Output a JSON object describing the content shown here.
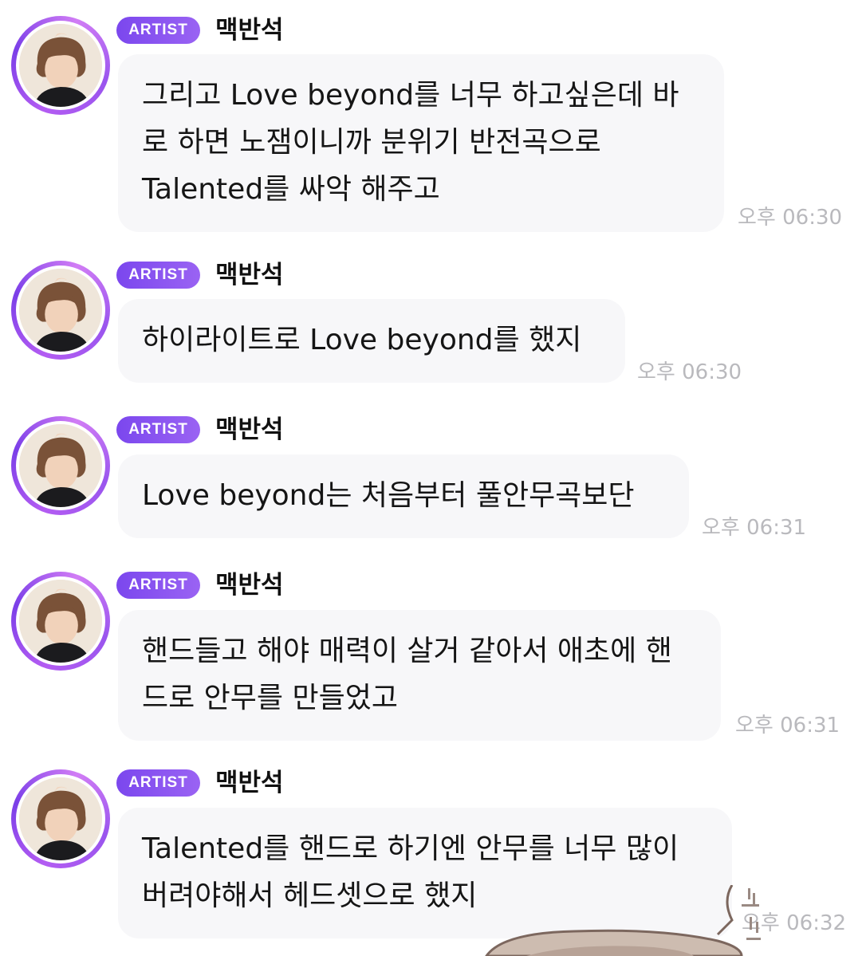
{
  "messages": [
    {
      "badge": "ARTIST",
      "sender": "맥반석",
      "text": "그리고 Love beyond를 너무 하고싶은데 바\n로 하면 노잼이니까 분위기 반전곡으로\nTalented를 싸악 해주고",
      "time": "오후 06:30"
    },
    {
      "badge": "ARTIST",
      "sender": "맥반석",
      "text": "하이라이트로 Love beyond를 했지",
      "time": "오후 06:30"
    },
    {
      "badge": "ARTIST",
      "sender": "맥반석",
      "text": "Love beyond는 처음부터 풀안무곡보단",
      "time": "오후 06:31"
    },
    {
      "badge": "ARTIST",
      "sender": "맥반석",
      "text": "핸드들고 해야 매력이 살거 같아서 애초에 핸\n드로 안무를 만들었고",
      "time": "오후 06:31"
    },
    {
      "badge": "ARTIST",
      "sender": "맥반석",
      "text": "Talented를 핸드로 하기엔 안무를 너무 많이\n버려야해서 헤드셋으로 했지",
      "time": "오후 06:32"
    }
  ],
  "colors": {
    "badge_start": "#7b47ee",
    "badge_end": "#9a63f3",
    "bubble": "#f7f7f9",
    "time": "#b9b9bd"
  }
}
